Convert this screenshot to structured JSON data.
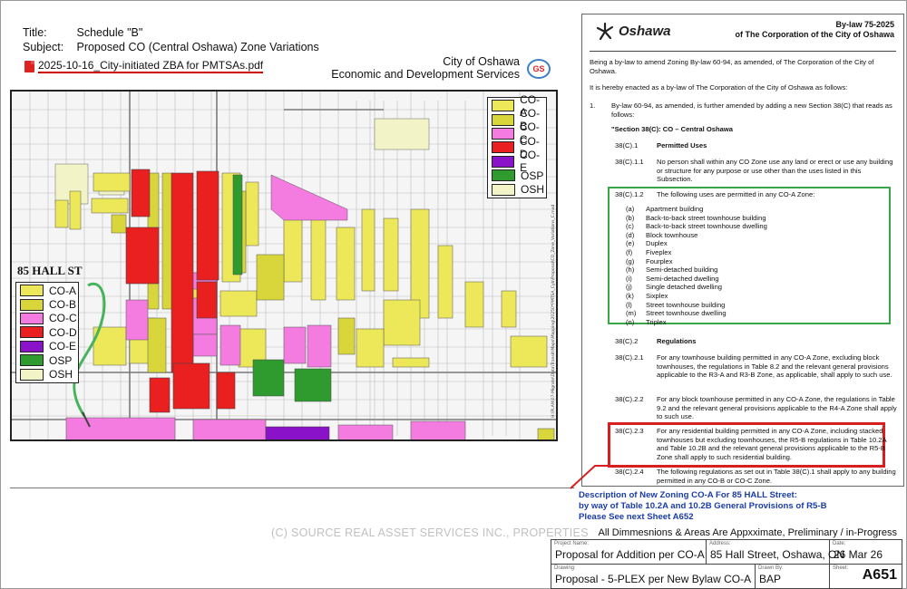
{
  "header": {
    "title_key": "Title:",
    "title_value": "Schedule \"B\"",
    "subject_key": "Subject:",
    "subject_value": "Proposed CO (Central Oshawa) Zone Variations",
    "pdf_prefix": "2025-10-16_",
    "pdf_link": "City-initiated ZBA for PMTSAs.pdf",
    "city": "City of Oshawa",
    "department": "Economic and Development Services",
    "logo_text": "GS"
  },
  "legend": {
    "items": [
      {
        "code": "CO-A",
        "color": "#ece85a"
      },
      {
        "code": "CO-B",
        "color": "#d8d63a"
      },
      {
        "code": "CO-C",
        "color": "#f47be0"
      },
      {
        "code": "CO-D",
        "color": "#ea1f1f"
      },
      {
        "code": "CO-E",
        "color": "#8a12c8"
      },
      {
        "code": "OSP",
        "color": "#2f9b2f"
      },
      {
        "code": "OSH",
        "color": "#f2f4c8"
      }
    ]
  },
  "hall_label": "85 HALL ST",
  "bylaw": {
    "logo": "Oshawa",
    "number": "By-law 75-2025",
    "of": "of The Corporation of the City of Oshawa",
    "intro1": "Being a by-law to amend Zoning By-law 60-94, as amended, of The Corporation of the City of Oshawa.",
    "intro2": "It is hereby enacted as a by-law of The Corporation of the City of Oshawa as follows:",
    "item1_num": "1.",
    "item1_text": "By-law 60-94, as amended, is further amended by adding a new Section 38(C) that reads as follows:",
    "section_title": "\"Section 38(C): CO – Central Oshawa",
    "c1_num": "38(C).1",
    "c1_title": "Permitted Uses",
    "c11_num": "38(C).1.1",
    "c11_text": "No person shall within any CO Zone use any land or erect or use any building or structure for any purpose or use other than the uses listed in this Subsection.",
    "c12_num": "38(C).1.2",
    "c12_text": "The following uses are permitted in any CO-A Zone:",
    "uses": [
      {
        "l": "(a)",
        "t": "Apartment building"
      },
      {
        "l": "(b)",
        "t": "Back-to-back street townhouse building"
      },
      {
        "l": "(c)",
        "t": "Back-to-back street townhouse dwelling"
      },
      {
        "l": "(d)",
        "t": "Block townhouse"
      },
      {
        "l": "(e)",
        "t": "Duplex"
      },
      {
        "l": "(f)",
        "t": "Fiveplex"
      },
      {
        "l": "(g)",
        "t": "Fourplex"
      },
      {
        "l": "(h)",
        "t": "Semi-detached building"
      },
      {
        "l": "(i)",
        "t": "Semi-detached dwelling"
      },
      {
        "l": "(j)",
        "t": "Single detached dwelling"
      },
      {
        "l": "(k)",
        "t": "Sixplex"
      },
      {
        "l": "(l)",
        "t": "Street townhouse building"
      },
      {
        "l": "(m)",
        "t": "Street townhouse dwelling"
      },
      {
        "l": "(n)",
        "t": "Triplex"
      }
    ],
    "c2_num": "38(C).2",
    "c2_title": "Regulations",
    "c21_num": "38(C).2.1",
    "c21_text": "For any townhouse building permitted in any CO-A Zone, excluding block townhouses, the regulations in Table 8.2 and the relevant general provisions applicable to the R3-A and R3-B Zone, as applicable, shall apply to such use.",
    "c22_num": "38(C).2.2",
    "c22_text": "For any block townhouse permitted in any CO-A Zone, the regulations in Table 9.2 and the relevant general provisions applicable to the R4-A Zone shall apply to such use.",
    "c23_num": "38(C).2.3",
    "c23_text": "For any residential building permitted in any CO-A Zone, including stacked townhouses but excluding townhouses, the R5-B regulations in Table 10.2A and Table 10.2B and the relevant general provisions applicable to the R5-B Zone shall apply to such residential building.",
    "c24_num": "38(C).2.4",
    "c24_text": "The following regulations as set out in Table 38(C).1 shall apply to any building permitted in any CO-B or CO-C Zone."
  },
  "description": {
    "line1": "Description of New Zoning CO-A For 85 HALL Street:",
    "line2": "by way of Table 10.2A and 10.2B General Provisions of R5-B",
    "line3": "Please See next Sheet A652"
  },
  "dims_note": "All Dimmesnions & Areas Are Appxximate, Preliminary / in-Progress",
  "watermark": "(C) SOURCE REAL ASSET SERVICES INC., PROPERTIES",
  "title_block": {
    "project_label": "Project Name:",
    "project": "Proposal for Addition per CO-A",
    "address_label": "Address:",
    "address": "85 Hall Street, Oshawa, ON",
    "date_label": "Date:",
    "date": "26 Mar 26",
    "drawing_label": "Drawing:",
    "drawing": "Proposal - 5-PLEX per New Bylaw CO-A",
    "drawn_label": "Drawn By:",
    "drawn": "BAP",
    "sheet_label": "Sheet:",
    "sheet": "A651"
  }
}
